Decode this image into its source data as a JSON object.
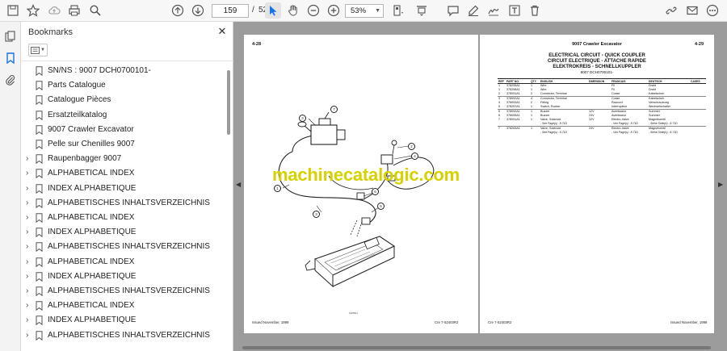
{
  "toolbar": {
    "current_page": "159",
    "page_separator": "/",
    "total_pages": "528",
    "zoom": "53%"
  },
  "bookmarks": {
    "title": "Bookmarks",
    "close_glyph": "✕",
    "items": [
      {
        "label": "SN/NS : 9007 DCH0700101-",
        "expandable": false
      },
      {
        "label": "Parts Catalogue",
        "expandable": false
      },
      {
        "label": "Catalogue Pièces",
        "expandable": false
      },
      {
        "label": "Ersatzteilkatalog",
        "expandable": false
      },
      {
        "label": "9007 Crawler Excavator",
        "expandable": false
      },
      {
        "label": "Pelle sur Chenilles 9007",
        "expandable": false
      },
      {
        "label": "Raupenbagger 9007",
        "expandable": true
      },
      {
        "label": "ALPHABETICAL INDEX",
        "expandable": true
      },
      {
        "label": "INDEX ALPHABETIQUE",
        "expandable": true
      },
      {
        "label": "ALPHABETISCHES INHALTSVERZEICHNIS",
        "expandable": true
      },
      {
        "label": "ALPHABETICAL INDEX",
        "expandable": true
      },
      {
        "label": "INDEX ALPHABETIQUE",
        "expandable": true
      },
      {
        "label": "ALPHABETISCHES INHALTSVERZEICHNIS",
        "expandable": true
      },
      {
        "label": "ALPHABETICAL INDEX",
        "expandable": true
      },
      {
        "label": "INDEX ALPHABETIQUE",
        "expandable": true
      },
      {
        "label": "ALPHABETISCHES INHALTSVERZEICHNIS",
        "expandable": true
      },
      {
        "label": "ALPHABETICAL INDEX",
        "expandable": true
      },
      {
        "label": "INDEX ALPHABETIQUE",
        "expandable": true
      },
      {
        "label": "ALPHABETISCHES INHALTSVERZEICHNIS",
        "expandable": true
      }
    ]
  },
  "left_page": {
    "page_number": "4-28",
    "figure_code": "12050H",
    "footer_left": "Issued November, 1999",
    "footer_right": "Cre 7-52403R2",
    "callouts": [
      "1",
      "2",
      "3",
      "4",
      "5",
      "6",
      "7"
    ]
  },
  "right_page": {
    "header_model": "9007 Crawler Excavator",
    "page_number": "4-29",
    "title_en": "ELECTRICAL CIRCUIT - QUICK COUPLER",
    "title_fr": "CIRCUIT ELECTRIQUE - ATTACHE RAPIDE",
    "title_de": "ELEKTROKREIS - SCHNELLKUPPLER",
    "serial": "9007 DCH0700101-",
    "footer_left": "Cre 7-52403R2",
    "footer_right": "Issued November, 1999",
    "columns": [
      "REF",
      "PART NO.",
      "QTY",
      "ENGLISH",
      "DIMENSION",
      "FRANCAIS",
      "DEUTSCH",
      "CASES"
    ],
    "rows": [
      {
        "ref": "1",
        "part": "378255A1",
        "qty": "1",
        "en": "Wire",
        "dim": "",
        "fr": "Fil",
        "de": "Draht",
        "sep": false
      },
      {
        "ref": "1",
        "part": "378256A1",
        "qty": "1",
        "en": "Wire",
        "dim": "",
        "fr": "Fil",
        "de": "Draht",
        "sep": false
      },
      {
        "ref": "2",
        "part": "378051A1",
        "qty": "2",
        "en": "Connector, Terminal",
        "dim": "",
        "fr": "Cosse",
        "de": "Kabelschuh",
        "sep": false
      },
      {
        "ref": "3",
        "part": "378052A1",
        "qty": "4",
        "en": "Connector, Terminal",
        "dim": "",
        "fr": "Cosse",
        "de": "Kabelschuh",
        "sep": true
      },
      {
        "ref": "4",
        "part": "378053A1",
        "qty": "2",
        "en": "Fitting",
        "dim": "",
        "fr": "Raccord",
        "de": "Verschraubung",
        "sep": false
      },
      {
        "ref": "5",
        "part": "378257A1",
        "qty": "1",
        "en": "Switch, Rocker",
        "dim": "",
        "fr": "Interrupteur",
        "de": "Wechselschalter",
        "sep": false
      },
      {
        "ref": "6",
        "part": "378052A1",
        "qty": "1",
        "en": "Buzzer",
        "dim": "12V",
        "fr": "Avertisseur",
        "de": "Summer",
        "sep": true
      },
      {
        "ref": "6",
        "part": "378055A1",
        "qty": "1",
        "en": "Buzzer",
        "dim": "24V",
        "fr": "Avertisseur",
        "de": "Summer",
        "sep": false
      },
      {
        "ref": "7",
        "part": "378051A1",
        "qty": "1",
        "en": "Valve, Solenoid",
        "dim": "12V",
        "fr": "Electro-Valve",
        "de": "Magnetventil",
        "sep": false
      },
      {
        "ref": "",
        "part": "",
        "qty": "",
        "en": "- See Page(s) : 8-71D",
        "dim": "",
        "fr": "- Voir Page(s) : 8-71D",
        "de": "- Siehe Seite(n) : 8-71D",
        "sep": false,
        "note": true
      },
      {
        "ref": "7",
        "part": "378263A1",
        "qty": "1",
        "en": "Valve, Solenoid",
        "dim": "24V",
        "fr": "Electro-Valve",
        "de": "Magnetventil",
        "sep": true
      },
      {
        "ref": "",
        "part": "",
        "qty": "",
        "en": "- See Page(s) : 8-71D",
        "dim": "",
        "fr": "- Voir Page(s) : 8-71D",
        "de": "- Siehe Seite(n) : 8-71D",
        "sep": false,
        "note": true
      }
    ]
  },
  "watermark": "machinecatalogic.com",
  "colors": {
    "toolbar_bg": "#f7f7f7",
    "doc_bg": "#9c9c9c",
    "watermark": "#d7d100",
    "accent_blue": "#1473e6"
  }
}
